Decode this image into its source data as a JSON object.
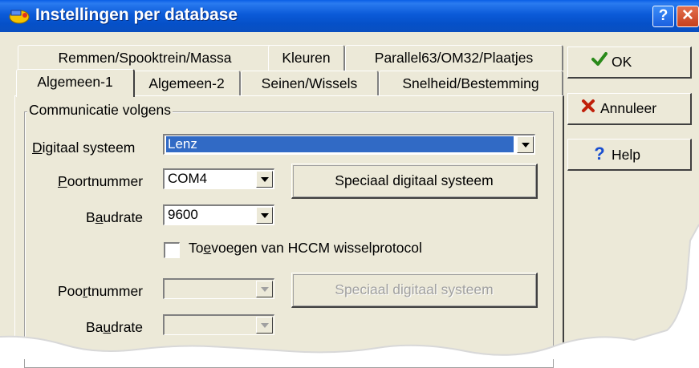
{
  "window": {
    "title": "Instellingen per database",
    "help_glyph": "?",
    "close_glyph": "✕"
  },
  "tabs": {
    "row1": [
      "Remmen/Spooktrein/Massa",
      "Kleuren",
      "Parallel63/OM32/Plaatjes"
    ],
    "row2": [
      "Algemeen-1",
      "Algemeen-2",
      "Seinen/Wissels",
      "Snelheid/Bestemming"
    ]
  },
  "group": {
    "title": "Communicatie volgens"
  },
  "form": {
    "digitaal_label": "Digitaal systeem",
    "digitaal_value": "Lenz",
    "poort1_label": "Poortnummer",
    "poort1_value": "COM4",
    "speciaal1_label": "Speciaal digitaal systeem",
    "baud1_label": "Baudrate",
    "baud1_value": "9600",
    "hccm_label": "Toevoegen van HCCM wisselprotocol",
    "poort2_label": "Poortnummer",
    "poort2_value": "",
    "speciaal2_label": "Speciaal digitaal systeem",
    "baud2_label": "Baudrate",
    "baud2_value": ""
  },
  "buttons": {
    "ok": "OK",
    "cancel": "Annuleer",
    "help": "Help"
  },
  "icons": {
    "ok": "check-icon",
    "cancel": "x-icon",
    "help": "question-icon"
  },
  "colors": {
    "titlebar": "#0550c8",
    "selection": "#316ac5",
    "ok_green": "#2a8a1a",
    "cancel_red": "#c0200a",
    "help_blue": "#1a4fd0"
  }
}
